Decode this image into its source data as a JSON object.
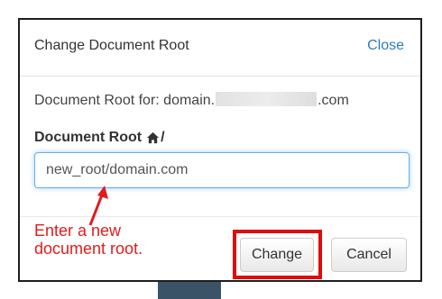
{
  "dialog": {
    "title": "Change Document Root",
    "close_label": "Close",
    "root_line": {
      "prefix": "Document Root for: domain.",
      "suffix": ".com"
    },
    "field": {
      "label": "Document Root",
      "home_icon": "home-icon",
      "slash": "/",
      "value": "new_root/domain.com"
    },
    "buttons": {
      "change": "Change",
      "cancel": "Cancel"
    }
  },
  "annotation": {
    "line1": "Enter a new",
    "line2": "document root.",
    "color": "#e31b1b"
  },
  "colors": {
    "link": "#2b7bc3",
    "focus_border": "#66afe9",
    "highlight": "#e00b0b"
  }
}
